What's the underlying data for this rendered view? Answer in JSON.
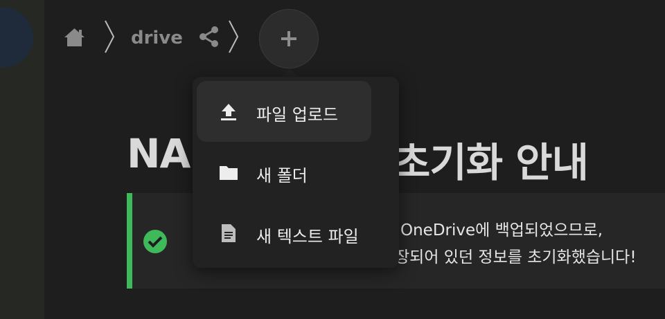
{
  "breadcrumb": {
    "home_icon": "home-icon",
    "separator_icon": "chevron-right-icon",
    "folder": "drive",
    "share_icon": "share-icon",
    "add_icon": "plus-icon"
  },
  "page": {
    "title_left": "NAS",
    "title_right": "초기화 안내"
  },
  "notice": {
    "icon": "check-circle-icon",
    "color": "#3fba5b",
    "line1_right": "OneDrive에 백업되었으므로,",
    "line2_right": "장되어 있던 정보를 초기화했습니다!"
  },
  "menu": {
    "items": [
      {
        "label": "파일 업로드",
        "icon": "upload-icon"
      },
      {
        "label": "새 폴더",
        "icon": "folder-icon"
      },
      {
        "label": "새 텍스트 파일",
        "icon": "document-icon"
      }
    ]
  }
}
